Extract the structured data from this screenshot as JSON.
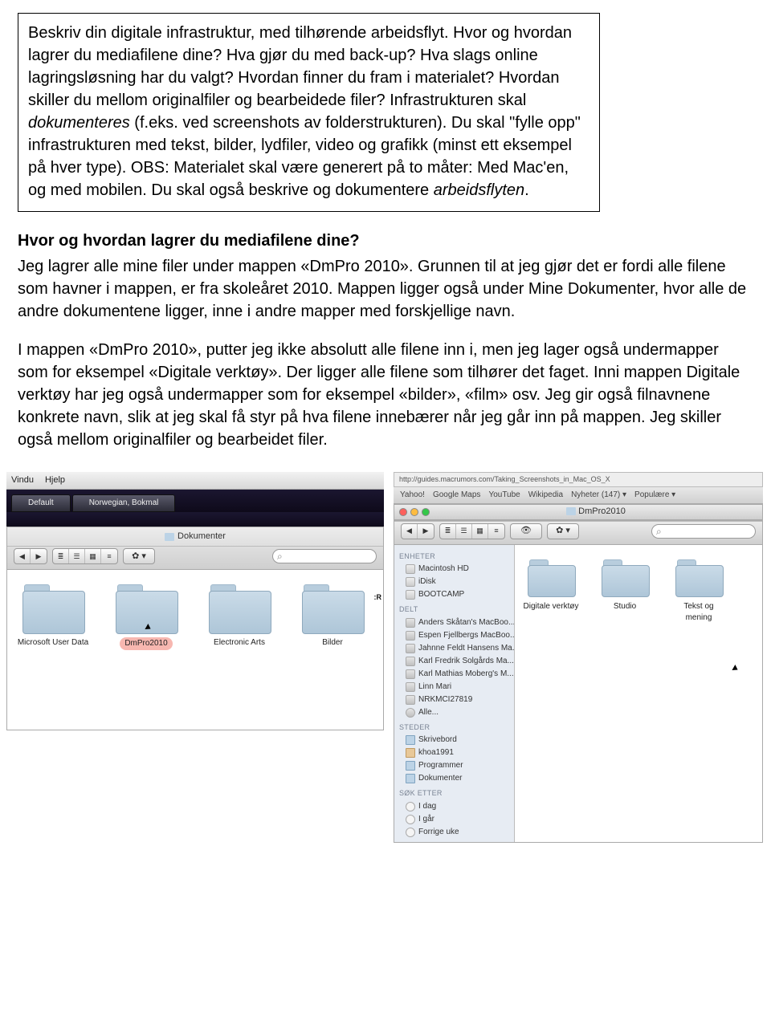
{
  "task_box": {
    "line1": "Beskriv din digitale infrastruktur, med tilhørende arbeidsflyt. Hvor og hvordan lagrer du mediafilene dine? Hva gjør du med back-up? Hva slags online lagringsløsning har du valgt? Hvordan finner du fram i materialet? Hvordan skiller du mellom originalfiler og bearbeidede filer? Infrastrukturen skal ",
    "italic1": "dokumenteres",
    "line1b": " (f.eks. ved screenshots av folderstrukturen). Du skal \"fylle opp\" infrastrukturen med tekst, bilder, lydfiler, video og grafikk (minst ett eksempel på hver type). OBS: Materialet skal være generert på to måter: Med Mac'en, og med mobilen. Du skal også beskrive og dokumentere ",
    "italic2": "arbeidsflyten",
    "line1c": "."
  },
  "q1": "Hvor og hvordan lagrer du mediafilene dine?",
  "p1": "Jeg lagrer alle mine filer under mappen «DmPro 2010». Grunnen til at jeg gjør det er fordi alle filene som havner i mappen, er fra skoleåret 2010. Mappen ligger også under Mine Dokumenter, hvor alle de andre dokumentene ligger, inne i andre mapper med forskjellige navn.",
  "p2": "I mappen «DmPro 2010», putter jeg ikke absolutt alle filene inn i, men jeg lager også undermapper som for eksempel «Digitale verktøy». Der ligger alle filene som tilhører det faget. Inni mappen Digitale verktøy har jeg også undermapper som for eksempel «bilder», «film» osv. Jeg gir også filnavnene konkrete navn, slik at jeg skal få styr på hva filene innebærer når jeg går inn på mappen. Jeg skiller også mellom originalfiler og bearbeidet filer.",
  "left_shot": {
    "menu": {
      "item1": "Vindu",
      "item2": "Hjelp"
    },
    "tabs": {
      "t1": "Default",
      "t2": "Norwegian, Bokmal"
    },
    "window_title": "Dokumenter",
    "folders": [
      {
        "label": "Microsoft User Data"
      },
      {
        "label": "DmPro2010",
        "selected": true
      },
      {
        "label": "Electronic Arts"
      },
      {
        "label": "Bilder"
      }
    ],
    "right_edge_text": ":R"
  },
  "right_shot": {
    "url": "http://guides.macrumors.com/Taking_Screenshots_in_Mac_OS_X",
    "bookmarks": [
      "Yahoo!",
      "Google Maps",
      "YouTube",
      "Wikipedia",
      "Nyheter (147) ▾",
      "Populære ▾"
    ],
    "window_title": "DmPro2010",
    "sidebar": {
      "g1": "ENHETER",
      "g1_items": [
        "Macintosh HD",
        "iDisk",
        "BOOTCAMP"
      ],
      "g2": "DELT",
      "g2_items": [
        "Anders Skåtan's MacBoo...",
        "Espen Fjellbergs MacBoo...",
        "Jahnne Feldt Hansens Ma...",
        "Karl Fredrik Solgårds Ma...",
        "Karl Mathias Moberg's M...",
        "Linn Mari",
        "NRKMCI27819",
        "Alle..."
      ],
      "g3": "STEDER",
      "g3_items": [
        "Skrivebord",
        "khoa1991",
        "Programmer",
        "Dokumenter"
      ],
      "g4": "SØK ETTER",
      "g4_items": [
        "I dag",
        "I går",
        "Forrige uke"
      ]
    },
    "folders": [
      {
        "label": "Digitale verktøy"
      },
      {
        "label": "Studio"
      },
      {
        "label": "Tekst og mening"
      }
    ]
  }
}
